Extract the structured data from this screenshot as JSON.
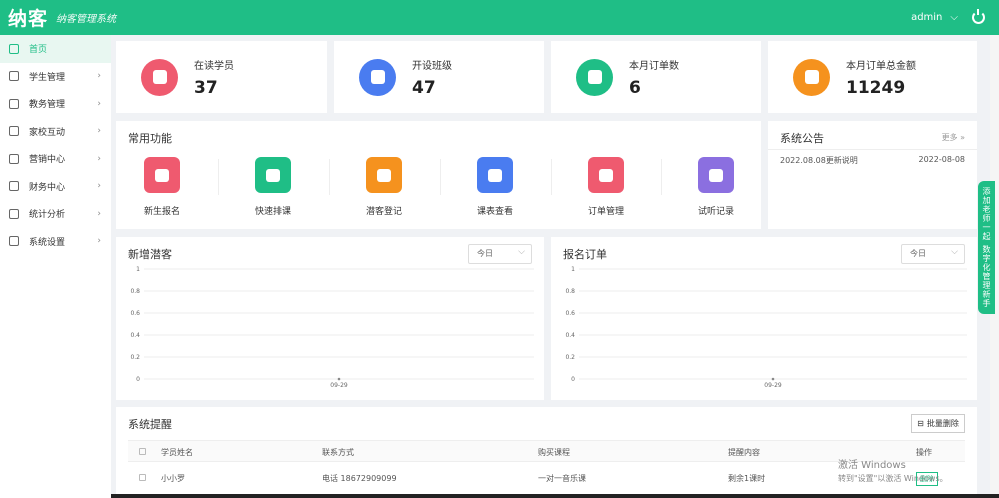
{
  "header": {
    "logo": "纳客",
    "slogan": "纳客管理系统",
    "user": "admin",
    "dropdown_arrow": "⌵",
    "power_icon": "power-icon"
  },
  "sidebar": {
    "items": [
      {
        "label": "首页",
        "icon": "home-icon",
        "arrow": ""
      },
      {
        "label": "学生管理",
        "icon": "student-icon",
        "arrow": "›"
      },
      {
        "label": "教务管理",
        "icon": "book-icon",
        "arrow": "›"
      },
      {
        "label": "家校互动",
        "icon": "chat-icon",
        "arrow": "›"
      },
      {
        "label": "营销中心",
        "icon": "gift-icon",
        "arrow": "›"
      },
      {
        "label": "财务中心",
        "icon": "wallet-icon",
        "arrow": "›"
      },
      {
        "label": "统计分析",
        "icon": "chart-icon",
        "arrow": "›"
      },
      {
        "label": "系统设置",
        "icon": "gear-icon",
        "arrow": "›"
      }
    ]
  },
  "stats": [
    {
      "label": "在读学员",
      "value": "37",
      "color": "#ef5a6f",
      "icon": "user-icon"
    },
    {
      "label": "开设班级",
      "value": "47",
      "color": "#4a7cf0",
      "icon": "building-icon"
    },
    {
      "label": "本月订单数",
      "value": "6",
      "color": "#1fbe86",
      "icon": "document-icon"
    },
    {
      "label": "本月订单总金额",
      "value": "11249",
      "color": "#f5921e",
      "icon": "money-bag-icon"
    }
  ],
  "functions": {
    "title": "常用功能",
    "items": [
      {
        "label": "新生报名",
        "color": "#ef5a6f",
        "icon": "user-plus-icon"
      },
      {
        "label": "快速排课",
        "color": "#1fbe86",
        "icon": "calendar-check-icon"
      },
      {
        "label": "潜客登记",
        "color": "#f5921e",
        "icon": "heart-user-icon"
      },
      {
        "label": "课表查看",
        "color": "#4a7cf0",
        "icon": "calendar-icon"
      },
      {
        "label": "订单管理",
        "color": "#ef5a6f",
        "icon": "order-icon"
      },
      {
        "label": "试听记录",
        "color": "#8b6fe0",
        "icon": "open-book-icon"
      }
    ]
  },
  "notice": {
    "title": "系统公告",
    "more": "更多 »",
    "entry_text": "2022.08.08更新说明",
    "entry_date": "2022-08-08"
  },
  "leads_chart": {
    "title": "新增潜客",
    "filter": "今日"
  },
  "orders_chart": {
    "title": "报名订单",
    "filter": "今日"
  },
  "chart_data": [
    {
      "type": "line",
      "title": "新增潜客",
      "x": [
        "09-29"
      ],
      "series": [
        {
          "values": [
            0
          ]
        }
      ],
      "ylim": [
        0,
        1
      ],
      "yticks": [
        "0",
        "0.2",
        "0.4",
        "0.6",
        "0.8",
        "1"
      ],
      "grid": true
    },
    {
      "type": "line",
      "title": "报名订单",
      "x": [
        "09-29"
      ],
      "series": [
        {
          "values": [
            0
          ]
        }
      ],
      "ylim": [
        0,
        1
      ],
      "yticks": [
        "0",
        "0.2",
        "0.4",
        "0.6",
        "0.8",
        "1"
      ],
      "grid": true
    }
  ],
  "remind": {
    "title": "系统提醒",
    "button": "批量删除",
    "columns": [
      "学员姓名",
      "联系方式",
      "购买课程",
      "提醒内容",
      "操作"
    ],
    "rows": [
      {
        "name": "小小罗",
        "phone": "电话 18672909099",
        "course": "一对一音乐课",
        "content": "剩余1课时",
        "op": "删除"
      }
    ]
  },
  "float_tab": {
    "text": "添加老师一起",
    "text2": "数字化管理新手"
  },
  "watermark": {
    "line1": "激活 Windows",
    "line2": "转到\"设置\"以激活 Windows。"
  }
}
